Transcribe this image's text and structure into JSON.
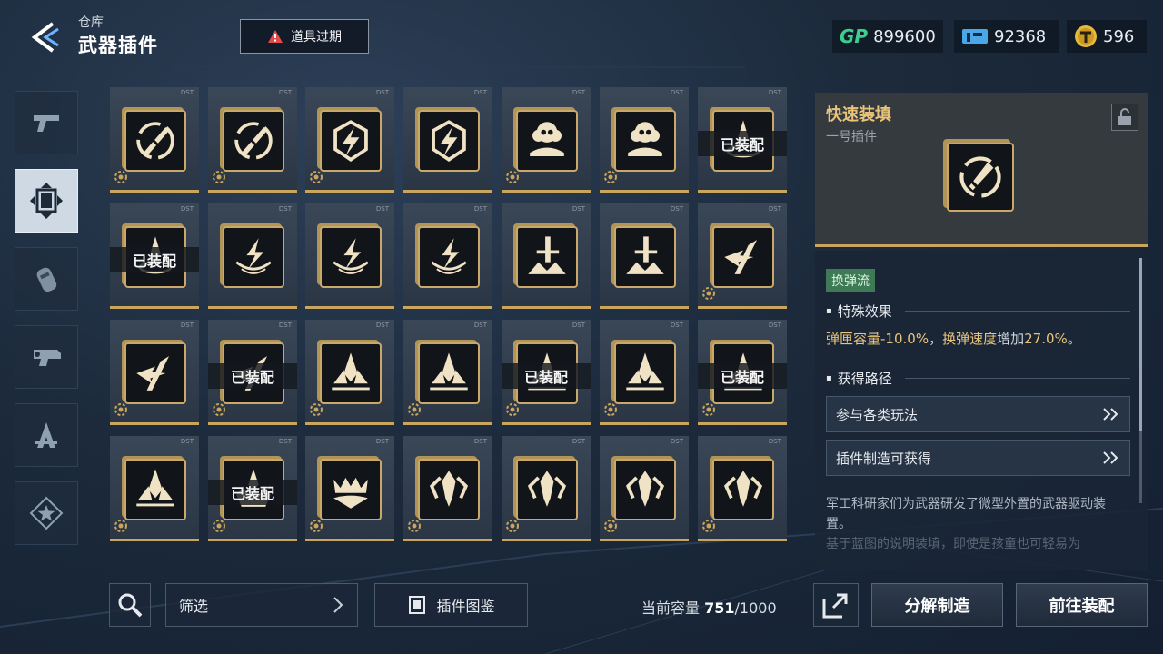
{
  "header": {
    "breadcrumb": "仓库",
    "title": "武器插件",
    "expire_label": "道具过期",
    "currencies": [
      {
        "name": "gp",
        "label": "GP",
        "value": "899600"
      },
      {
        "name": "ticket",
        "label": "",
        "value": "92368"
      },
      {
        "name": "coin",
        "label": "",
        "value": "596"
      }
    ]
  },
  "side_tabs": [
    "pistol-icon",
    "plugin-icon",
    "grenade-icon",
    "gun-part-icon",
    "gear-kit-icon",
    "star-badge-icon"
  ],
  "grid": {
    "equipped_label": "已装配",
    "items": [
      {
        "icon": "slash-circle",
        "equipped": false,
        "gear": true
      },
      {
        "icon": "slash-circle",
        "equipped": false,
        "gear": true
      },
      {
        "icon": "lightning-shield",
        "equipped": false,
        "gear": true
      },
      {
        "icon": "lightning-shield",
        "equipped": false,
        "gear": false
      },
      {
        "icon": "skull-cloud",
        "equipped": false,
        "gear": true
      },
      {
        "icon": "skull-cloud",
        "equipped": false,
        "gear": true
      },
      {
        "icon": "flame-ring",
        "equipped": true,
        "gear": false
      },
      {
        "icon": "flame-ring",
        "equipped": true,
        "gear": false
      },
      {
        "icon": "lightning-ring",
        "equipped": false,
        "gear": false
      },
      {
        "icon": "lightning-ring",
        "equipped": false,
        "gear": false
      },
      {
        "icon": "lightning-ring",
        "equipped": false,
        "gear": false
      },
      {
        "icon": "sword-burst",
        "equipped": false,
        "gear": false
      },
      {
        "icon": "sword-burst",
        "equipped": false,
        "gear": false
      },
      {
        "icon": "wing-arrow",
        "equipped": false,
        "gear": true
      },
      {
        "icon": "wing-arrow",
        "equipped": false,
        "gear": true
      },
      {
        "icon": "wing-arrow",
        "equipped": true,
        "gear": true
      },
      {
        "icon": "crystal-spike",
        "equipped": false,
        "gear": true
      },
      {
        "icon": "crystal-spike",
        "equipped": false,
        "gear": true
      },
      {
        "icon": "crystal-spike",
        "equipped": true,
        "gear": true
      },
      {
        "icon": "crystal-spike",
        "equipped": false,
        "gear": true
      },
      {
        "icon": "crystal-spike",
        "equipped": true,
        "gear": true
      },
      {
        "icon": "crystal-spike",
        "equipped": false,
        "gear": true
      },
      {
        "icon": "crown-spike",
        "equipped": true,
        "gear": true
      },
      {
        "icon": "crown-wave",
        "equipped": false,
        "gear": true
      },
      {
        "icon": "bug-claw",
        "equipped": false,
        "gear": true
      },
      {
        "icon": "bug-claw",
        "equipped": false,
        "gear": true
      },
      {
        "icon": "bug-claw",
        "equipped": false,
        "gear": true
      },
      {
        "icon": "bug-claw",
        "equipped": false,
        "gear": true
      }
    ]
  },
  "toolbar": {
    "filter_label": "筛选",
    "codex_label": "插件图鉴",
    "capacity_label": "当前容量",
    "capacity_used": "751",
    "capacity_total": "/1000",
    "disassemble_label": "分解制造",
    "equip_label": "前往装配"
  },
  "detail": {
    "name": "快速装填",
    "subtitle": "一号插件",
    "style_tag": "换弹流",
    "effect_title": "特殊效果",
    "effect": {
      "k1": "弹匣容量",
      "v1": "-10.0%",
      "sep": "，",
      "k2": "换弹速度",
      "w": "增加",
      "v2": "27.0%",
      "end": "。"
    },
    "source_title": "获得路径",
    "routes": [
      "参与各类玩法",
      "插件制造可获得"
    ],
    "description_1": "军工科研家们为武器研发了微型外置的武器驱动装置。",
    "description_2": "基于蓝图的说明装填，即使是孩童也可轻易为"
  },
  "colors": {
    "gold": "#c9a55d",
    "accent_text": "#e9c47a",
    "tag_green": "#3e7a55",
    "gp_green": "#3ccf8e"
  }
}
